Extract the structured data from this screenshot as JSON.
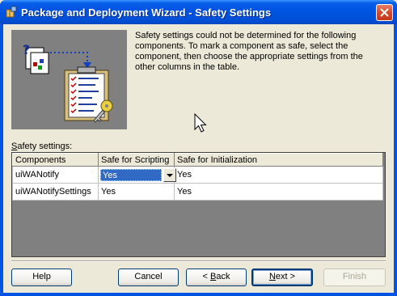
{
  "window": {
    "title": "Package and Deployment Wizard - Safety Settings",
    "app_icon": "package-wizard-icon",
    "close_icon": "close-icon",
    "accent_color": "#0054e3"
  },
  "description": "Safety settings could not be determined for the following components. To mark a component as safe, select the component, then choose the appropriate settings from the other columns in the table.",
  "illustration": "safety-settings-illustration",
  "grid": {
    "label_accel": "S",
    "label_rest": "afety settings:",
    "columns": [
      "Components",
      "Safe for Scripting",
      "Safe for Initialization"
    ],
    "rows": [
      {
        "component": "uiWANotify",
        "scripting": "Yes",
        "initialization": "Yes",
        "scripting_editing": true
      },
      {
        "component": "uiWANotifySettings",
        "scripting": "Yes",
        "initialization": "Yes",
        "scripting_editing": false
      }
    ]
  },
  "buttons": {
    "help": "Help",
    "cancel": "Cancel",
    "back_prefix": "< ",
    "back_accel": "B",
    "back_rest": "ack",
    "next_accel": "N",
    "next_rest": "ext >",
    "finish": "Finish"
  }
}
